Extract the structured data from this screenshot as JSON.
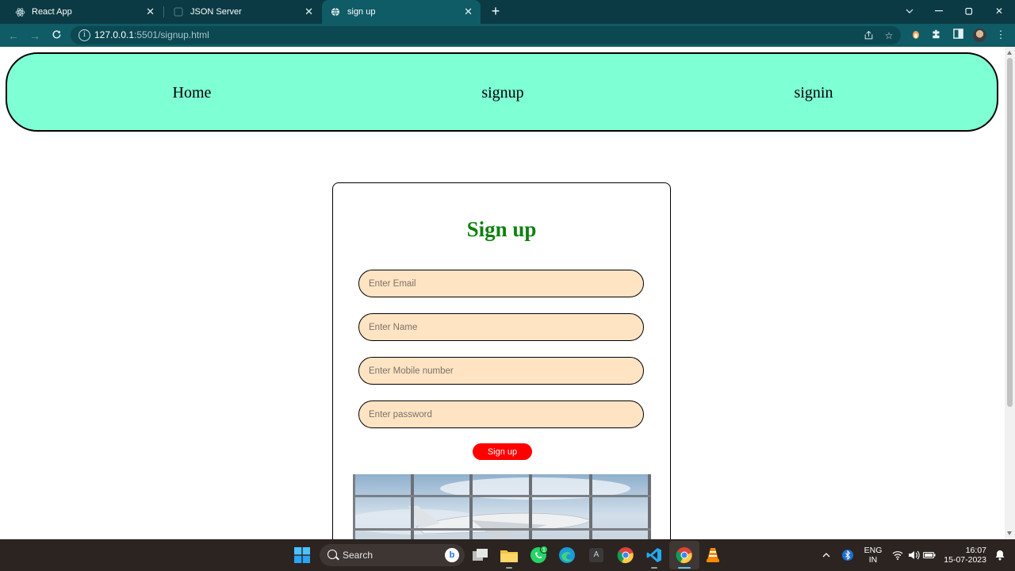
{
  "browser": {
    "tabs": [
      {
        "title": "React App",
        "icon": "react-icon",
        "active": false
      },
      {
        "title": "JSON Server",
        "icon": "json-server-icon",
        "active": false
      },
      {
        "title": "sign up",
        "icon": "globe-icon",
        "active": true
      }
    ],
    "url_host": "127.0.0.1",
    "url_path": ":5501/signup.html",
    "colors": {
      "tabbar": "#0b3a44",
      "toolbar": "#0f5b66"
    }
  },
  "page": {
    "nav": {
      "links": [
        "Home",
        "signup",
        "signin"
      ],
      "background": "#7fffd4"
    },
    "form": {
      "title": "Sign up",
      "title_color": "#118011",
      "fields": [
        {
          "placeholder": "Enter Email",
          "value": ""
        },
        {
          "placeholder": "Enter Name",
          "value": ""
        },
        {
          "placeholder": "Enter Mobile number",
          "value": ""
        },
        {
          "placeholder": "Enter password",
          "value": ""
        }
      ],
      "field_background": "#ffe4c4",
      "submit_label": "Sign up",
      "submit_color": "#ff0000"
    }
  },
  "taskbar": {
    "search_placeholder": "Search",
    "whatsapp_badge": "1",
    "language": "ENG",
    "region": "IN",
    "time": "16:07",
    "date": "15-07-2023"
  }
}
